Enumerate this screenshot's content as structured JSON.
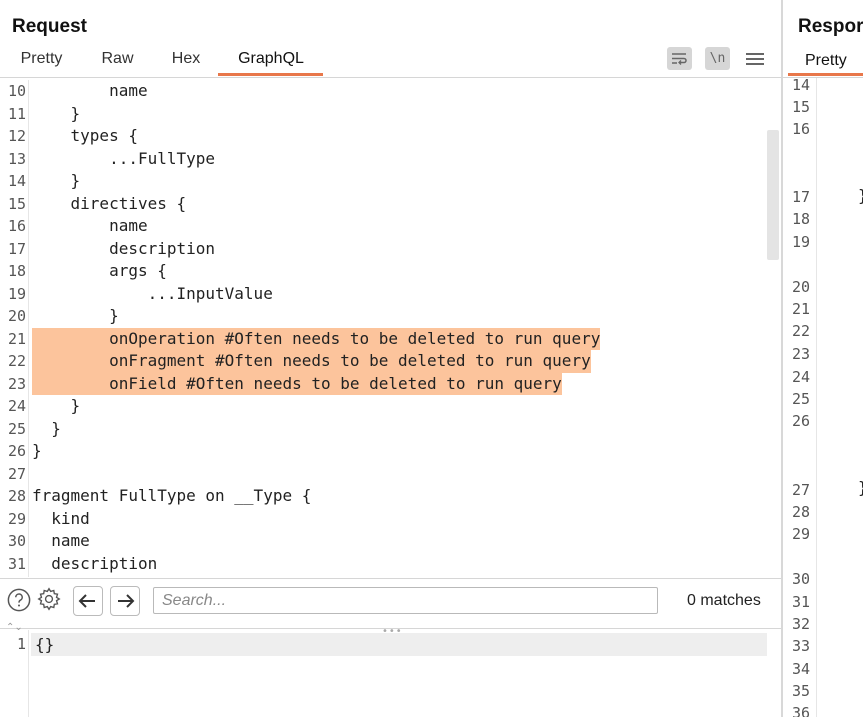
{
  "request": {
    "title": "Request",
    "tabs": [
      "Pretty",
      "Raw",
      "Hex",
      "GraphQL"
    ],
    "active_tab": "GraphQL",
    "toolbar": {
      "wrap_icon": "wrap-lines-icon",
      "newline_label": "\\n",
      "menu_icon": "hamburger-menu-icon"
    },
    "lines": [
      {
        "n": "10",
        "text": "        name",
        "hl": false
      },
      {
        "n": "11",
        "text": "    }",
        "hl": false
      },
      {
        "n": "12",
        "text": "    types {",
        "hl": false
      },
      {
        "n": "13",
        "text": "        ...FullType",
        "hl": false
      },
      {
        "n": "14",
        "text": "    }",
        "hl": false
      },
      {
        "n": "15",
        "text": "    directives {",
        "hl": false
      },
      {
        "n": "16",
        "text": "        name",
        "hl": false
      },
      {
        "n": "17",
        "text": "        description",
        "hl": false
      },
      {
        "n": "18",
        "text": "        args {",
        "hl": false
      },
      {
        "n": "19",
        "text": "            ...InputValue",
        "hl": false
      },
      {
        "n": "20",
        "text": "        }",
        "hl": false
      },
      {
        "n": "21",
        "text": "        onOperation #Often needs to be deleted to run query",
        "hl": true
      },
      {
        "n": "22",
        "text": "        onFragment #Often needs to be deleted to run query",
        "hl": true
      },
      {
        "n": "23",
        "text": "        onField #Often needs to be deleted to run query",
        "hl": true
      },
      {
        "n": "24",
        "text": "    }",
        "hl": false
      },
      {
        "n": "25",
        "text": "  }",
        "hl": false
      },
      {
        "n": "26",
        "text": "}",
        "hl": false
      },
      {
        "n": "27",
        "text": "",
        "hl": false
      },
      {
        "n": "28",
        "text": "fragment FullType on __Type {",
        "hl": false
      },
      {
        "n": "29",
        "text": "  kind",
        "hl": false
      },
      {
        "n": "30",
        "text": "  name",
        "hl": false
      },
      {
        "n": "31",
        "text": "  description",
        "hl": false
      }
    ],
    "search": {
      "placeholder": "Search...",
      "value": "",
      "matches": "0 matches"
    },
    "variables": {
      "line_number": "1",
      "text": "{}"
    }
  },
  "response": {
    "title": "Respor",
    "tab": "Pretty",
    "line_numbers": [
      "14",
      "15",
      "16",
      "17",
      "18",
      "19",
      "20",
      "21",
      "22",
      "23",
      "24",
      "25",
      "26",
      "27",
      "28",
      "29",
      "30",
      "31",
      "32",
      "33",
      "34",
      "35",
      "36"
    ],
    "brace": "}"
  },
  "colors": {
    "accent": "#e8774a",
    "highlight": "#fcc49c"
  }
}
